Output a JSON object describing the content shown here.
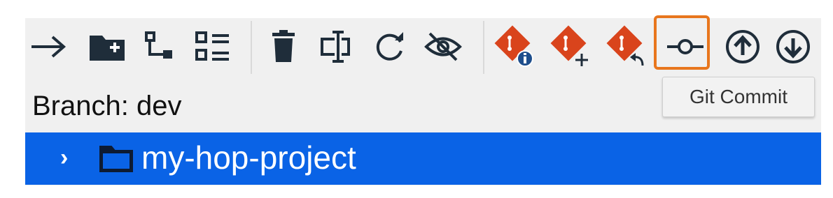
{
  "toolbar": {
    "buttons": [
      {
        "icon": "arrow-right-icon",
        "name": "navigate-button"
      },
      {
        "icon": "folder-plus-icon",
        "name": "new-folder-button"
      },
      {
        "icon": "tree-hierarchy-icon",
        "name": "hierarchy-button"
      },
      {
        "icon": "list-view-icon",
        "name": "list-view-button"
      },
      {
        "icon": "trash-icon",
        "name": "delete-button"
      },
      {
        "icon": "rename-field-icon",
        "name": "rename-button"
      },
      {
        "icon": "refresh-icon",
        "name": "refresh-button"
      },
      {
        "icon": "eye-slash-icon",
        "name": "hide-button"
      },
      {
        "icon": "git-info-icon",
        "name": "git-info-button"
      },
      {
        "icon": "git-add-icon",
        "name": "git-add-button"
      },
      {
        "icon": "git-revert-icon",
        "name": "git-revert-button"
      },
      {
        "icon": "git-commit-icon",
        "name": "git-commit-button"
      },
      {
        "icon": "arrow-up-circle-icon",
        "name": "git-push-button"
      },
      {
        "icon": "arrow-down-circle-icon",
        "name": "git-pull-button"
      }
    ],
    "highlight_color": "#e8761d",
    "git_color": "#d9441c",
    "dark_icon_color": "#1f2d3a"
  },
  "tooltip": {
    "text": "Git Commit"
  },
  "branch": {
    "label": "Branch: dev"
  },
  "tree": {
    "items": [
      {
        "label": "my-hop-project",
        "icon": "folder-icon",
        "selected": true
      }
    ],
    "selected_color": "#0a63e6"
  }
}
